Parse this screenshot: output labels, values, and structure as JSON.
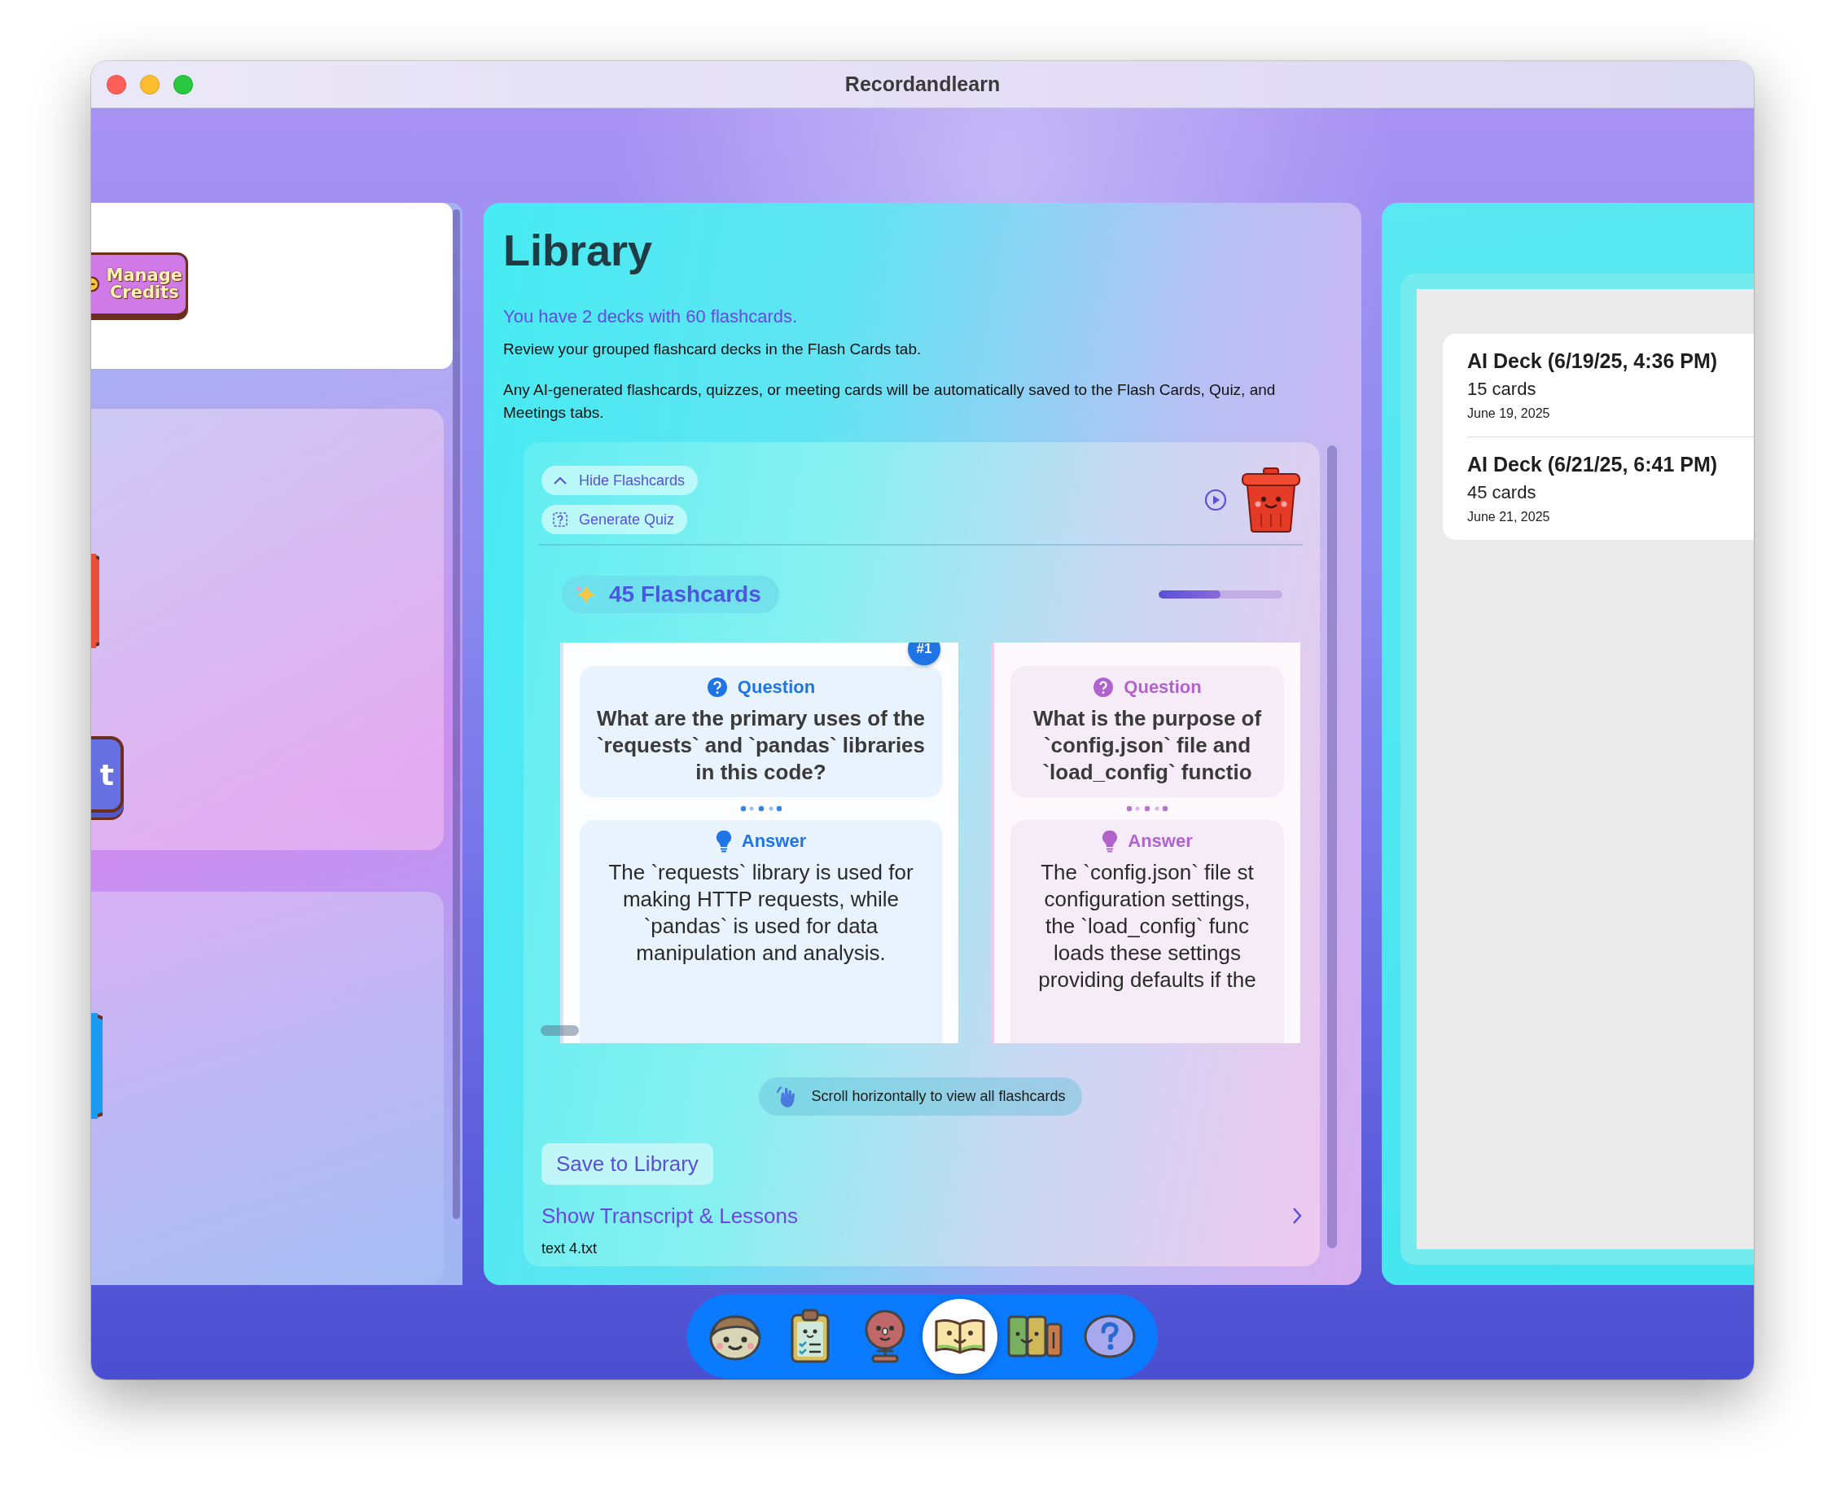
{
  "window": {
    "title": "Recordandlearn"
  },
  "left_panel": {
    "credits_button": "Manage Credits",
    "side_button": "t"
  },
  "library": {
    "title": "Library",
    "summary": "You have 2 decks with 60 flashcards.",
    "notes": [
      "Review your grouped flashcard decks in the Flash Cards tab.",
      "Any AI-generated flashcards, quizzes, or meeting cards will be automatically saved to the Flash Cards, Quiz, and Meetings tabs."
    ],
    "deck_view": {
      "actions": [
        {
          "kind": "collapse",
          "label": "Hide Flashcards"
        },
        {
          "kind": "quiz",
          "label": "Generate Quiz"
        }
      ],
      "count": "45 Flashcards",
      "progress": {
        "level": 0.5
      },
      "cards": [
        {
          "badge": "#1",
          "color": "#1f74e6",
          "question_label": "Question",
          "question": "What are the primary uses of the `requests` and `pandas` libraries in this code?",
          "answer_label": "Answer",
          "answer": "The `requests` library is used for making HTTP requests, while `pandas` is used for data manipulation and analysis."
        },
        {
          "color": "#b063cc",
          "question_label": "Question",
          "question": "What is the purpose of\n`config.json` file and\n`load_config` functio",
          "answer_label": "Answer",
          "answer": "The `config.json` file st\nconfiguration settings,\nthe `load_config` func\nloads these settings\nproviding defaults if the"
        }
      ],
      "hint": "Scroll horizontally to view all flashcards",
      "save_button": "Save to Library",
      "transcript_link": "Show Transcript & Lessons",
      "file_name": "text 4.txt"
    }
  },
  "decks": [
    {
      "title": "AI Deck (6/19/25, 4:36 PM)",
      "count": "15 cards",
      "date": "June 19, 2025"
    },
    {
      "title": "AI Deck (6/21/25, 6:41 PM)",
      "count": "45 cards",
      "date": "June 21, 2025"
    }
  ],
  "dock": [
    {
      "kind": "face",
      "selected": false
    },
    {
      "kind": "clipboard",
      "selected": false
    },
    {
      "kind": "microphone",
      "selected": false
    },
    {
      "kind": "book",
      "selected": true
    },
    {
      "kind": "books",
      "selected": false
    },
    {
      "kind": "help",
      "selected": false
    }
  ]
}
